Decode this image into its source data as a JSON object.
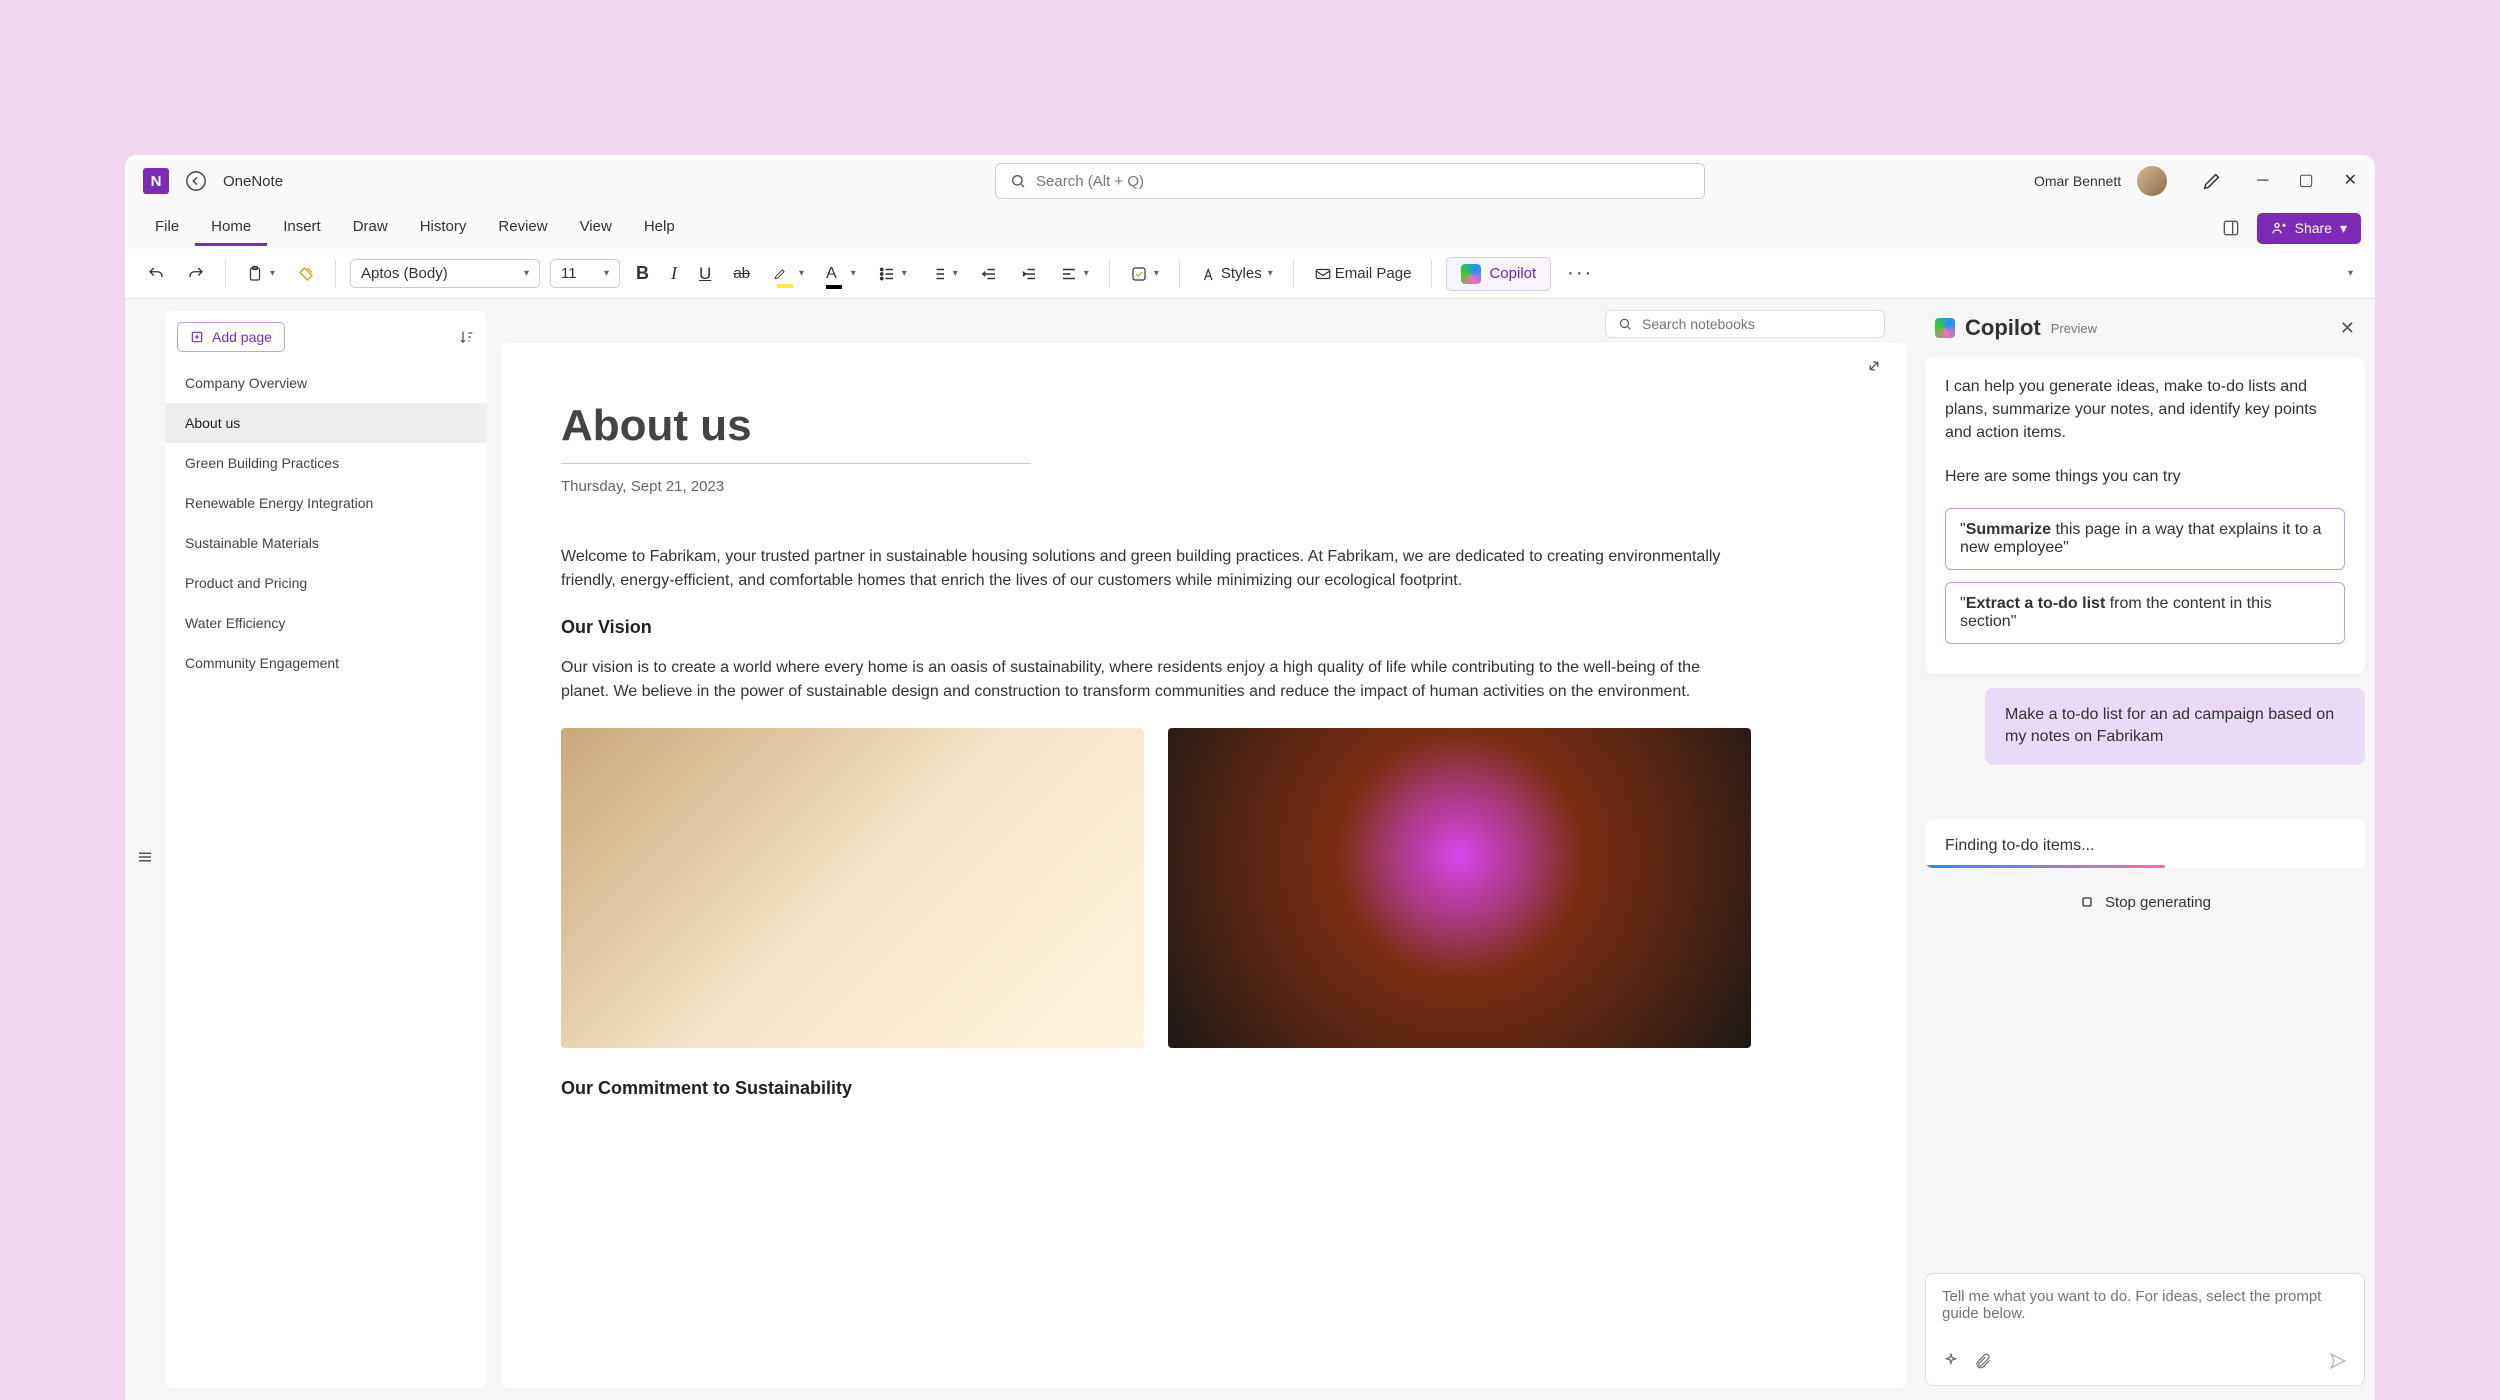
{
  "titlebar": {
    "app_letter": "N",
    "app_name": "OneNote",
    "search_placeholder": "Search (Alt + Q)",
    "user_name": "Omar Bennett"
  },
  "tabs": {
    "items": [
      "File",
      "Home",
      "Insert",
      "Draw",
      "History",
      "Review",
      "View",
      "Help"
    ],
    "active_index": 1,
    "share_label": "Share"
  },
  "toolbar": {
    "font_name": "Aptos (Body)",
    "font_size": "11",
    "styles_label": "Styles",
    "email_label": "Email Page",
    "copilot_label": "Copilot"
  },
  "search_row": {
    "notebooks_placeholder": "Search notebooks"
  },
  "pagelist": {
    "add_label": "Add page",
    "items": [
      "Company Overview",
      "About us",
      "Green Building Practices",
      "Renewable Energy Integration",
      "Sustainable Materials",
      "Product and Pricing",
      "Water Efficiency",
      "Community Engagement"
    ],
    "active_index": 1
  },
  "doc": {
    "title": "About us",
    "date": "Thursday, Sept 21, 2023",
    "intro": "Welcome to Fabrikam, your trusted partner in sustainable housing solutions and green building practices. At Fabrikam, we are dedicated to creating environmentally friendly, energy-efficient, and comfortable homes that enrich the lives of our customers while minimizing our ecological footprint.",
    "h_vision": "Our Vision",
    "vision": "Our vision is to create a world where every home is an oasis of sustainability, where residents enjoy a high quality of life while contributing to the well-being of the planet. We believe in the power of sustainable design and construction to transform communities and reduce the impact of human activities on the environment.",
    "h_commit": "Our Commitment to Sustainability"
  },
  "copilot": {
    "title": "Copilot",
    "preview": "Preview",
    "welcome1": "I can help you generate ideas, make to-do lists and plans, summarize your notes, and identify key points and action items.",
    "welcome2": "Here are some things you can try",
    "suggest1_bold": "Summarize",
    "suggest1_rest": " this page in a way that explains it to a new employee\"",
    "suggest2_bold": "Extract a to-do list",
    "suggest2_rest": " from the content in this section\"",
    "user_msg": "Make a to-do list for an ad campaign based on my notes on Fabrikam",
    "loading": "Finding to-do items...",
    "stop": "Stop generating",
    "input_placeholder": "Tell me what you want to do. For ideas, select the prompt guide below."
  }
}
